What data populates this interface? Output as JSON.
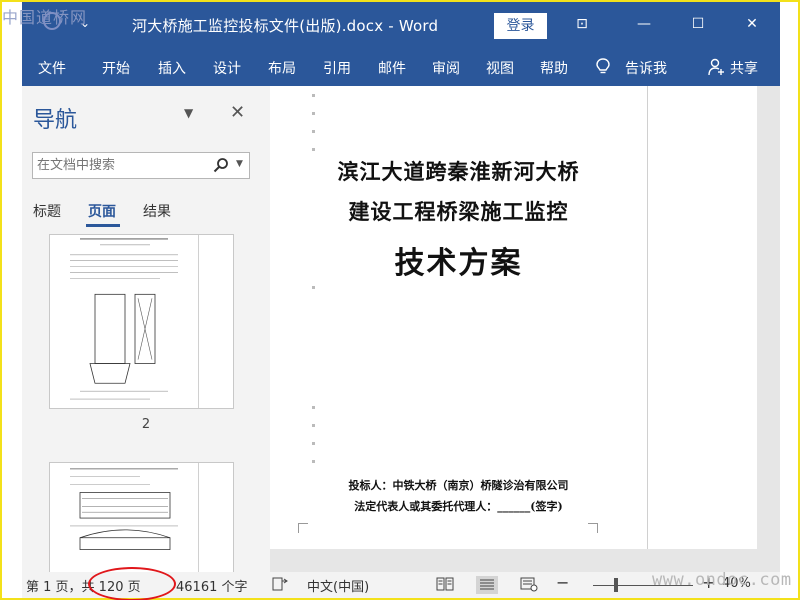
{
  "watermark_top": "中国道桥网",
  "watermark_bottom": "www.ondoc.com",
  "titlebar": {
    "quick_access": "⌄",
    "title": "河大桥施工监控投标文件(出版).docx - Word",
    "login_label": "登录",
    "restore_ribbon_label": "⊡",
    "minimize_label": "—",
    "maximize_label": "☐",
    "close_label": "✕"
  },
  "menu": {
    "items": [
      "文件",
      "开始",
      "插入",
      "设计",
      "布局",
      "引用",
      "邮件",
      "审阅",
      "视图",
      "帮助"
    ],
    "tell_me": "告诉我",
    "share": "共享"
  },
  "nav": {
    "title": "导航",
    "search_placeholder": "在文档中搜索",
    "tabs": [
      "标题",
      "页面",
      "结果"
    ],
    "active_tab": "页面",
    "page_number_label": "2"
  },
  "document": {
    "title_line1": "滨江大道跨秦淮新河大桥",
    "title_line2": "建设工程桥梁施工监控",
    "title_line3": "技术方案",
    "bidder_line": "投标人：中铁大桥（南京）桥隧诊治有限公司",
    "rep_line": "法定代表人或其委托代理人：______(签字)"
  },
  "status": {
    "page_info": "第 1 页，共 120 页",
    "word_count": "46161 个字",
    "language": "中文(中国)",
    "zoom": "40%",
    "zoom_value_percent": 40
  },
  "colors": {
    "accent": "#2b579a",
    "annotation": "#e0171b",
    "frame": "#f3e11a"
  }
}
